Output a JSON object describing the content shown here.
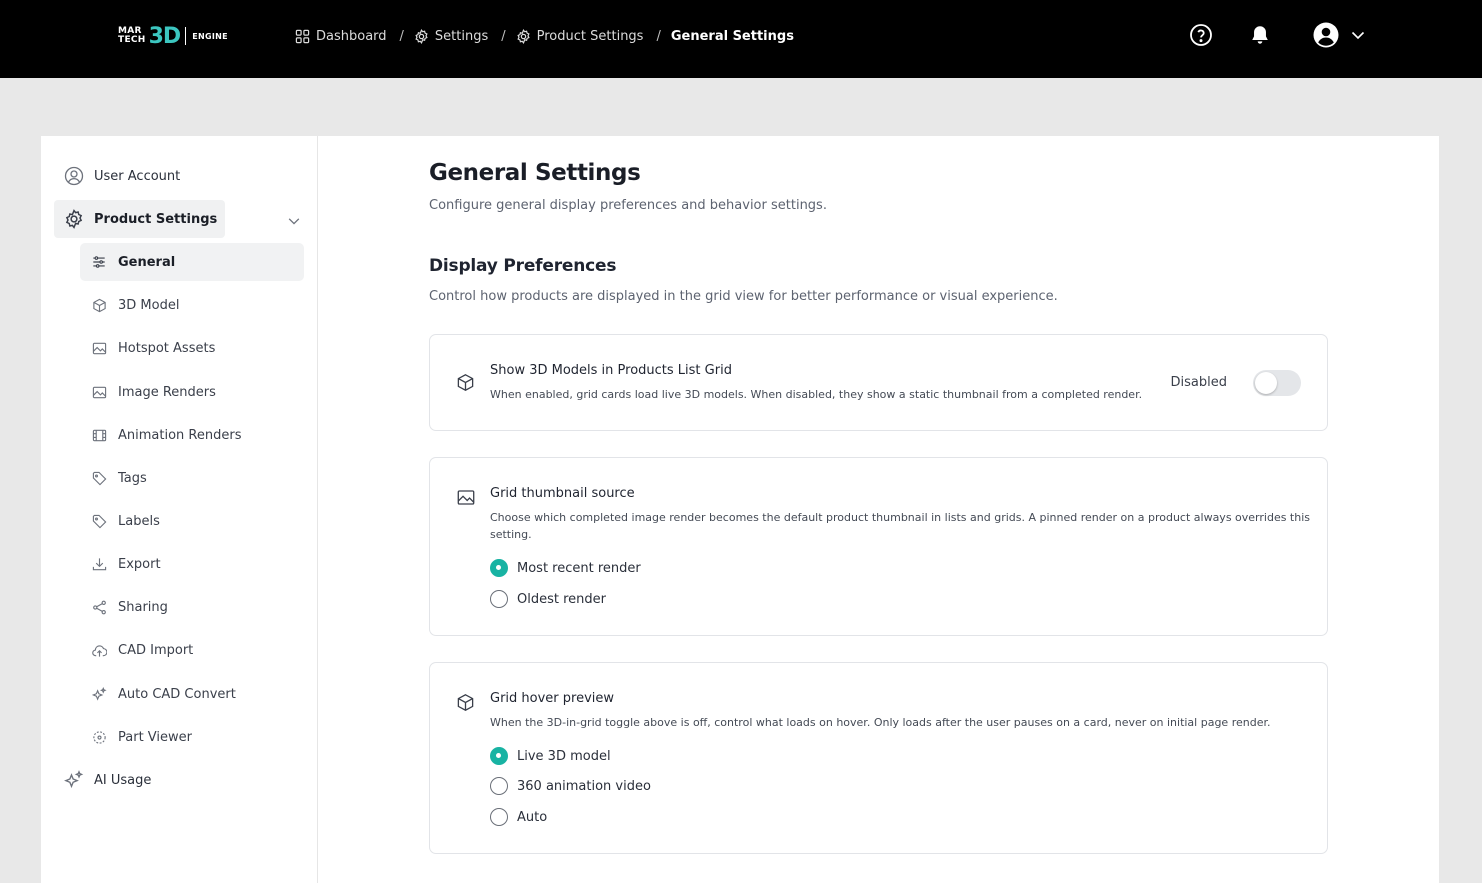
{
  "brand": {
    "logo_top": "MAR",
    "logo_bottom": "TECH",
    "logo_3d": "3D",
    "logo_engine": "ENGINE",
    "accent": "#3cc6c0"
  },
  "breadcrumb": [
    {
      "label": "Dashboard",
      "icon": "grid-icon"
    },
    {
      "label": "Settings",
      "icon": "gear-icon"
    },
    {
      "label": "Product Settings",
      "icon": "gear-icon"
    },
    {
      "label": "General Settings",
      "icon": null
    }
  ],
  "header_icons": [
    "help-icon",
    "bell-icon",
    "user-avatar-icon",
    "chevron-down-icon"
  ],
  "sidebar": {
    "top_items": [
      {
        "label": "User Account",
        "icon": "user-circle-icon"
      },
      {
        "label": "Product Settings",
        "icon": "gear-icon",
        "active": true,
        "expanded": true
      },
      {
        "label": "AI Usage",
        "icon": "sparkles-icon"
      }
    ],
    "sub_items": [
      {
        "label": "General",
        "icon": "sliders-icon",
        "active": true
      },
      {
        "label": "3D Model",
        "icon": "cube-icon"
      },
      {
        "label": "Hotspot Assets",
        "icon": "image-icon"
      },
      {
        "label": "Image Renders",
        "icon": "image-icon"
      },
      {
        "label": "Animation Renders",
        "icon": "film-icon"
      },
      {
        "label": "Tags",
        "icon": "tag-icon"
      },
      {
        "label": "Labels",
        "icon": "tag-icon"
      },
      {
        "label": "Export",
        "icon": "download-icon"
      },
      {
        "label": "Sharing",
        "icon": "share-icon"
      },
      {
        "label": "CAD Import",
        "icon": "cloud-upload-icon"
      },
      {
        "label": "Auto CAD Convert",
        "icon": "sparkles-icon"
      },
      {
        "label": "Part Viewer",
        "icon": "viewer-icon"
      }
    ]
  },
  "page": {
    "title": "General Settings",
    "subtitle": "Configure general display preferences and behavior settings.",
    "section_title": "Display Preferences",
    "section_subtitle": "Control how products are displayed in the grid view for better performance or visual experience."
  },
  "cards": {
    "show3d": {
      "title": "Show 3D Models in Products List Grid",
      "description": "When enabled, grid cards load live 3D models. When disabled, they show a static thumbnail from a completed render.",
      "toggle_label": "Disabled",
      "toggle_on": false
    },
    "thumbnail": {
      "title": "Grid thumbnail source",
      "description": "Choose which completed image render becomes the default product thumbnail in lists and grids. A pinned render on a product always overrides this setting.",
      "options": [
        "Most recent render",
        "Oldest render"
      ],
      "selected": "Most recent render"
    },
    "hover": {
      "title": "Grid hover preview",
      "description": "When the 3D-in-grid toggle above is off, control what loads on hover. Only loads after the user pauses on a card, never on initial page render.",
      "options": [
        "Live 3D model",
        "360 animation video",
        "Auto"
      ],
      "selected": "Live 3D model"
    }
  },
  "colors": {
    "radio_selected": "#18b3a3",
    "topbar": "#000000",
    "background": "#e8e8e8"
  }
}
